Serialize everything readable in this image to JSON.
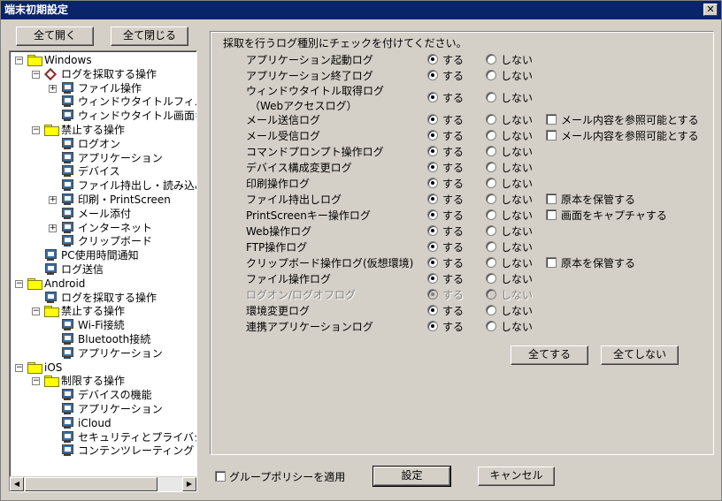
{
  "window": {
    "title": "端末初期設定",
    "close_glyph": "✕"
  },
  "tree_buttons": {
    "expand_all": "全て開く",
    "collapse_all": "全て閉じる"
  },
  "tree": [
    {
      "label": "Windows",
      "level": 0,
      "icon": "folder-icon",
      "expander": "−"
    },
    {
      "label": "ログを採取する操作",
      "level": 1,
      "icon": "diamond-icon",
      "expander": "−"
    },
    {
      "label": "ファイル操作",
      "level": 2,
      "icon": "computer-icon",
      "expander": "+"
    },
    {
      "label": "ウィンドウタイトルフィルタ",
      "level": 2,
      "icon": "computer-icon",
      "expander": ""
    },
    {
      "label": "ウィンドウタイトル画面キャ",
      "level": 2,
      "icon": "computer-icon",
      "expander": ""
    },
    {
      "label": "禁止する操作",
      "level": 1,
      "icon": "folder-icon",
      "expander": "−"
    },
    {
      "label": "ログオン",
      "level": 2,
      "icon": "computer-icon",
      "expander": ""
    },
    {
      "label": "アプリケーション",
      "level": 2,
      "icon": "computer-icon",
      "expander": ""
    },
    {
      "label": "デバイス",
      "level": 2,
      "icon": "computer-icon",
      "expander": ""
    },
    {
      "label": "ファイル持出し・読み込み",
      "level": 2,
      "icon": "computer-icon",
      "expander": ""
    },
    {
      "label": "印刷・PrintScreen",
      "level": 2,
      "icon": "computer-icon",
      "expander": "+"
    },
    {
      "label": "メール添付",
      "level": 2,
      "icon": "computer-icon",
      "expander": ""
    },
    {
      "label": "インターネット",
      "level": 2,
      "icon": "computer-icon",
      "expander": "+"
    },
    {
      "label": "クリップボード",
      "level": 2,
      "icon": "computer-icon",
      "expander": ""
    },
    {
      "label": "PC使用時間通知",
      "level": 1,
      "icon": "computer-icon",
      "expander": ""
    },
    {
      "label": "ログ送信",
      "level": 1,
      "icon": "computer-icon",
      "expander": ""
    },
    {
      "label": "Android",
      "level": 0,
      "icon": "folder-icon",
      "expander": "−"
    },
    {
      "label": "ログを採取する操作",
      "level": 1,
      "icon": "computer-icon",
      "expander": ""
    },
    {
      "label": "禁止する操作",
      "level": 1,
      "icon": "folder-icon",
      "expander": "−"
    },
    {
      "label": "Wi-Fi接続",
      "level": 2,
      "icon": "computer-icon",
      "expander": ""
    },
    {
      "label": "Bluetooth接続",
      "level": 2,
      "icon": "computer-icon",
      "expander": ""
    },
    {
      "label": "アプリケーション",
      "level": 2,
      "icon": "computer-icon",
      "expander": ""
    },
    {
      "label": "iOS",
      "level": 0,
      "icon": "folder-icon",
      "expander": "−"
    },
    {
      "label": "制限する操作",
      "level": 1,
      "icon": "folder-icon",
      "expander": "−"
    },
    {
      "label": "デバイスの機能",
      "level": 2,
      "icon": "computer-icon",
      "expander": ""
    },
    {
      "label": "アプリケーション",
      "level": 2,
      "icon": "computer-icon",
      "expander": ""
    },
    {
      "label": "iCloud",
      "level": 2,
      "icon": "computer-icon",
      "expander": ""
    },
    {
      "label": "セキュリティとプライバシー",
      "level": 2,
      "icon": "computer-icon",
      "expander": ""
    },
    {
      "label": "コンテンツレーティング",
      "level": 2,
      "icon": "computer-icon",
      "expander": ""
    }
  ],
  "scroll": {
    "left_glyph": "◀",
    "right_glyph": "▶"
  },
  "panel": {
    "instruction": "採取を行うログ種別にチェックを付けてください。",
    "on_label": "する",
    "off_label": "しない",
    "rows": [
      {
        "label": "アプリケーション起動ログ",
        "selected": "on",
        "disabled": false,
        "option": ""
      },
      {
        "label": "アプリケーション終了ログ",
        "selected": "on",
        "disabled": false,
        "option": ""
      },
      {
        "label": "ウィンドウタイトル取得ログ\n（Webアクセスログ）",
        "selected": "on",
        "disabled": false,
        "option": ""
      },
      {
        "label": "メール送信ログ",
        "selected": "on",
        "disabled": false,
        "option": "メール内容を参照可能とする"
      },
      {
        "label": "メール受信ログ",
        "selected": "on",
        "disabled": false,
        "option": "メール内容を参照可能とする"
      },
      {
        "label": "コマンドプロンプト操作ログ",
        "selected": "on",
        "disabled": false,
        "option": ""
      },
      {
        "label": "デバイス構成変更ログ",
        "selected": "on",
        "disabled": false,
        "option": ""
      },
      {
        "label": "印刷操作ログ",
        "selected": "on",
        "disabled": false,
        "option": ""
      },
      {
        "label": "ファイル持出しログ",
        "selected": "on",
        "disabled": false,
        "option": "原本を保管する"
      },
      {
        "label": "PrintScreenキー操作ログ",
        "selected": "on",
        "disabled": false,
        "option": "画面をキャプチャする"
      },
      {
        "label": "Web操作ログ",
        "selected": "on",
        "disabled": false,
        "option": ""
      },
      {
        "label": "FTP操作ログ",
        "selected": "on",
        "disabled": false,
        "option": ""
      },
      {
        "label": "クリップボード操作ログ(仮想環境)",
        "selected": "on",
        "disabled": false,
        "option": "原本を保管する"
      },
      {
        "label": "ファイル操作ログ",
        "selected": "on",
        "disabled": false,
        "option": ""
      },
      {
        "label": "ログオン/ログオフログ",
        "selected": "on",
        "disabled": true,
        "option": ""
      },
      {
        "label": "環境変更ログ",
        "selected": "on",
        "disabled": false,
        "option": ""
      },
      {
        "label": "連携アプリケーションログ",
        "selected": "on",
        "disabled": false,
        "option": ""
      }
    ],
    "all_on": "全てする",
    "all_off": "全てしない"
  },
  "footer": {
    "group_policy": "グループポリシーを適用",
    "apply": "設定",
    "cancel": "キャンセル"
  }
}
